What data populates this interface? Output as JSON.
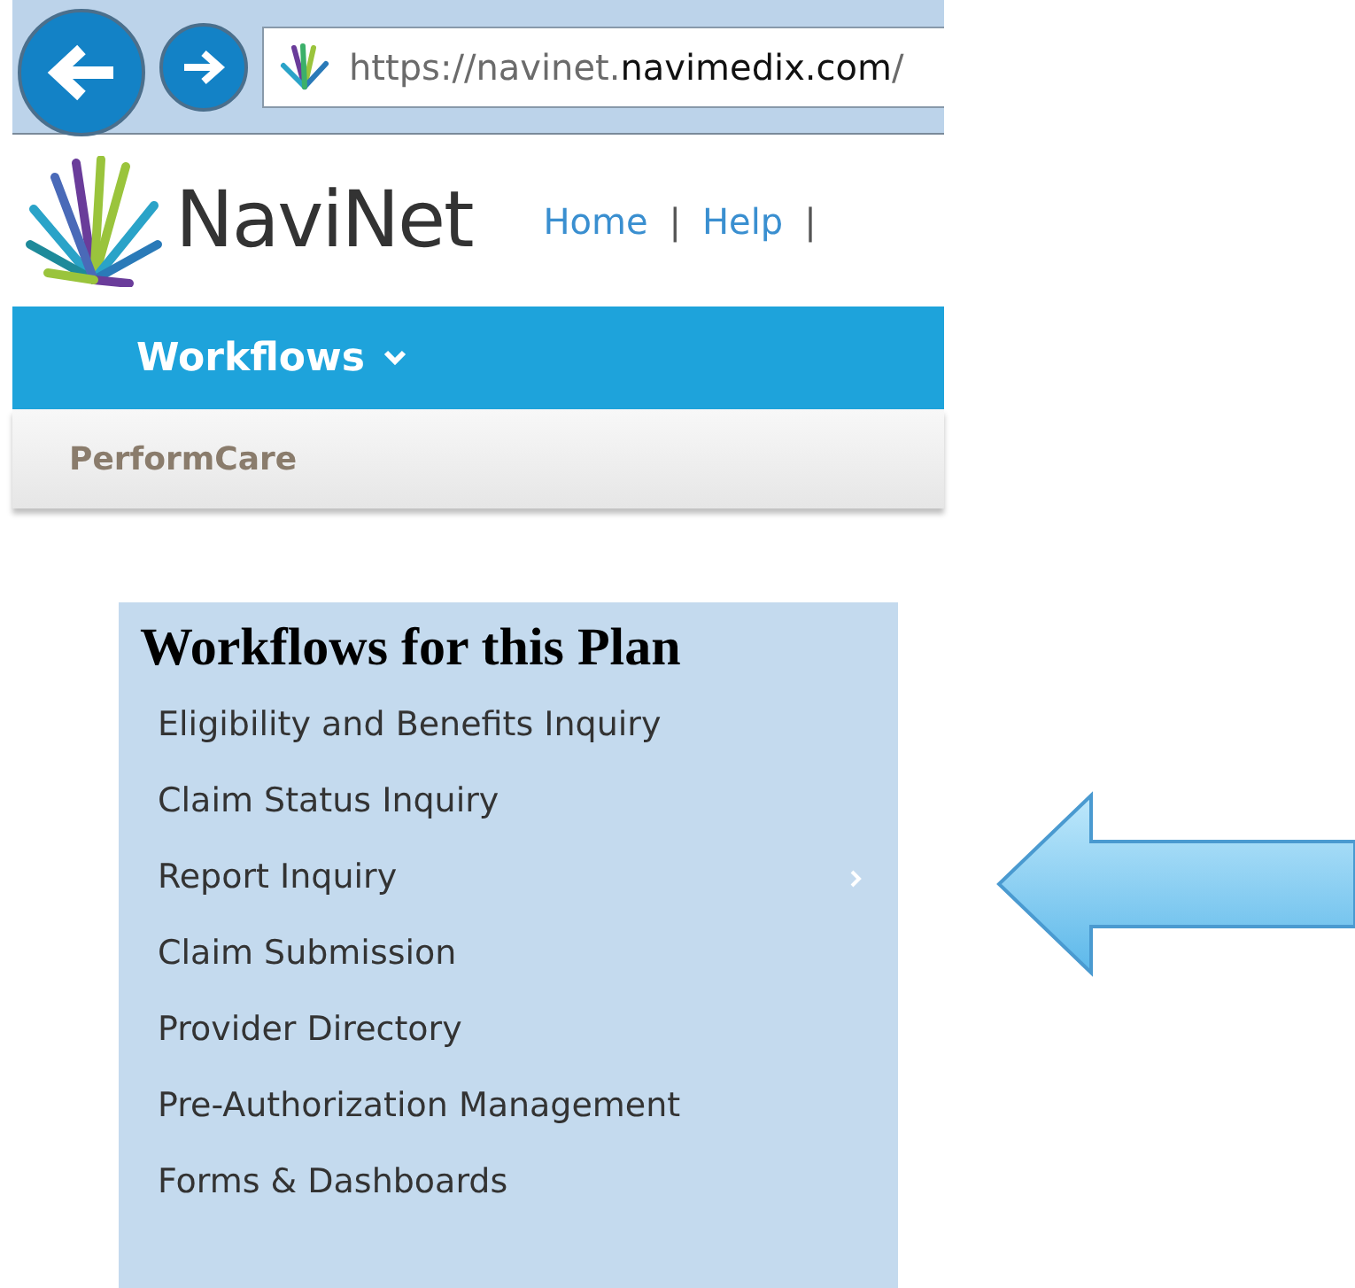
{
  "browser": {
    "url_parts": [
      {
        "text": "https://navinet.",
        "emphasis": false
      },
      {
        "text": "navimedix.com",
        "emphasis": true
      },
      {
        "text": "/",
        "emphasis": false
      }
    ]
  },
  "header": {
    "logo_text": "NaviNet",
    "links": [
      {
        "kind": "link",
        "text": "Home"
      },
      {
        "kind": "separator",
        "text": "|"
      },
      {
        "kind": "link",
        "text": "Help"
      },
      {
        "kind": "separator",
        "text": "|"
      }
    ]
  },
  "nav": {
    "menu_label": "Workflows"
  },
  "plan_bar": {
    "plan_name": "PerformCare"
  },
  "workflows_panel": {
    "title": "Workflows for this Plan",
    "items": [
      {
        "label": "Eligibility and Benefits Inquiry",
        "has_submenu": false
      },
      {
        "label": "Claim Status Inquiry",
        "has_submenu": false
      },
      {
        "label": "Report Inquiry",
        "has_submenu": true
      },
      {
        "label": "Claim Submission",
        "has_submenu": false
      },
      {
        "label": "Provider Directory",
        "has_submenu": false
      },
      {
        "label": "Pre-Authorization Management",
        "has_submenu": false
      },
      {
        "label": "Forms & Dashboards",
        "has_submenu": false
      }
    ]
  }
}
